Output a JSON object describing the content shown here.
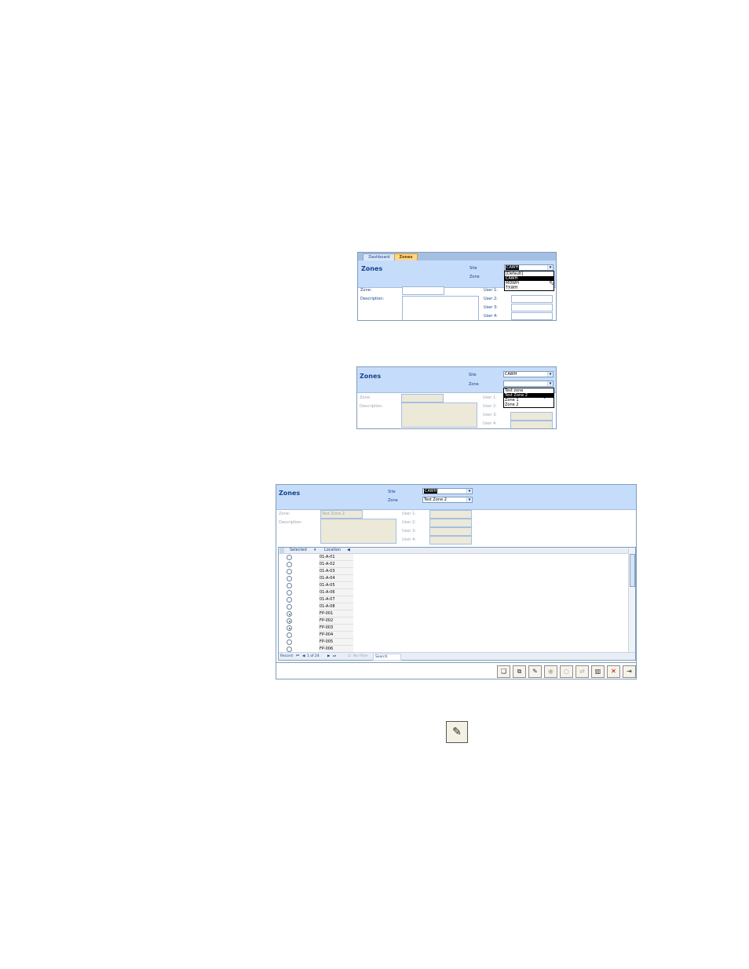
{
  "shot1": {
    "tabs": [
      {
        "label": "Dashboard"
      },
      {
        "label": "Zones"
      }
    ],
    "title": "Zones",
    "site_label": "Site",
    "zone_label": "Zone",
    "site_value": "CAWH",
    "site_options": [
      "[Default]",
      "CAWH",
      "MDWH",
      "TXWH"
    ],
    "site_selected": "CAWH",
    "zone_field_label": "Zone:",
    "description_label": "Description:",
    "user_labels": [
      "User 1:",
      "User 2:",
      "User 3:",
      "User 4:"
    ]
  },
  "shot2": {
    "title": "Zones",
    "site_label": "Site",
    "zone_label": "Zone",
    "site_value": "CAWH",
    "zone_options": [
      "Test zone",
      "Test Zone 2",
      "Zone 1",
      "Zone 2"
    ],
    "zone_selected": "Test Zone 2",
    "zone_field_label": "Zone:",
    "description_label": "Description:",
    "user_labels": [
      "User 1:",
      "User 2:",
      "User 3:",
      "User 4:"
    ]
  },
  "shot3": {
    "title": "Zones",
    "site_label": "Site",
    "zone_label": "Zone",
    "site_value": "CAWH",
    "zone_value": "Test Zone 2",
    "zone_field_label": "Zone:",
    "zone_field_value": "Test Zone 2",
    "description_label": "Description:",
    "user_labels": [
      "User 1:",
      "User 2:",
      "User 3:",
      "User 4:"
    ],
    "grid": {
      "columns": [
        "Selected",
        "Location"
      ],
      "rows": [
        {
          "selected": false,
          "location": "01-A-01"
        },
        {
          "selected": false,
          "location": "01-A-02"
        },
        {
          "selected": false,
          "location": "01-A-03"
        },
        {
          "selected": false,
          "location": "01-A-04"
        },
        {
          "selected": false,
          "location": "01-A-05"
        },
        {
          "selected": false,
          "location": "01-A-06"
        },
        {
          "selected": false,
          "location": "01-A-07"
        },
        {
          "selected": false,
          "location": "01-A-08"
        },
        {
          "selected": true,
          "location": "FP-001"
        },
        {
          "selected": true,
          "location": "FP-002"
        },
        {
          "selected": true,
          "location": "FP-003"
        },
        {
          "selected": false,
          "location": "FP-004"
        },
        {
          "selected": false,
          "location": "FP-005"
        },
        {
          "selected": false,
          "location": "FP-006"
        }
      ],
      "nav": {
        "record_label": "Record:",
        "position": "1 of 24",
        "filter": "No Filter",
        "search": "Search"
      }
    },
    "toolbar_icons": [
      "new-icon",
      "copy-icon",
      "edit-icon",
      "select-all-icon",
      "clear-icon",
      "move-icon",
      "delete-file-icon",
      "cancel-icon",
      "exit-icon"
    ]
  },
  "standalone_icon": "edit-icon"
}
